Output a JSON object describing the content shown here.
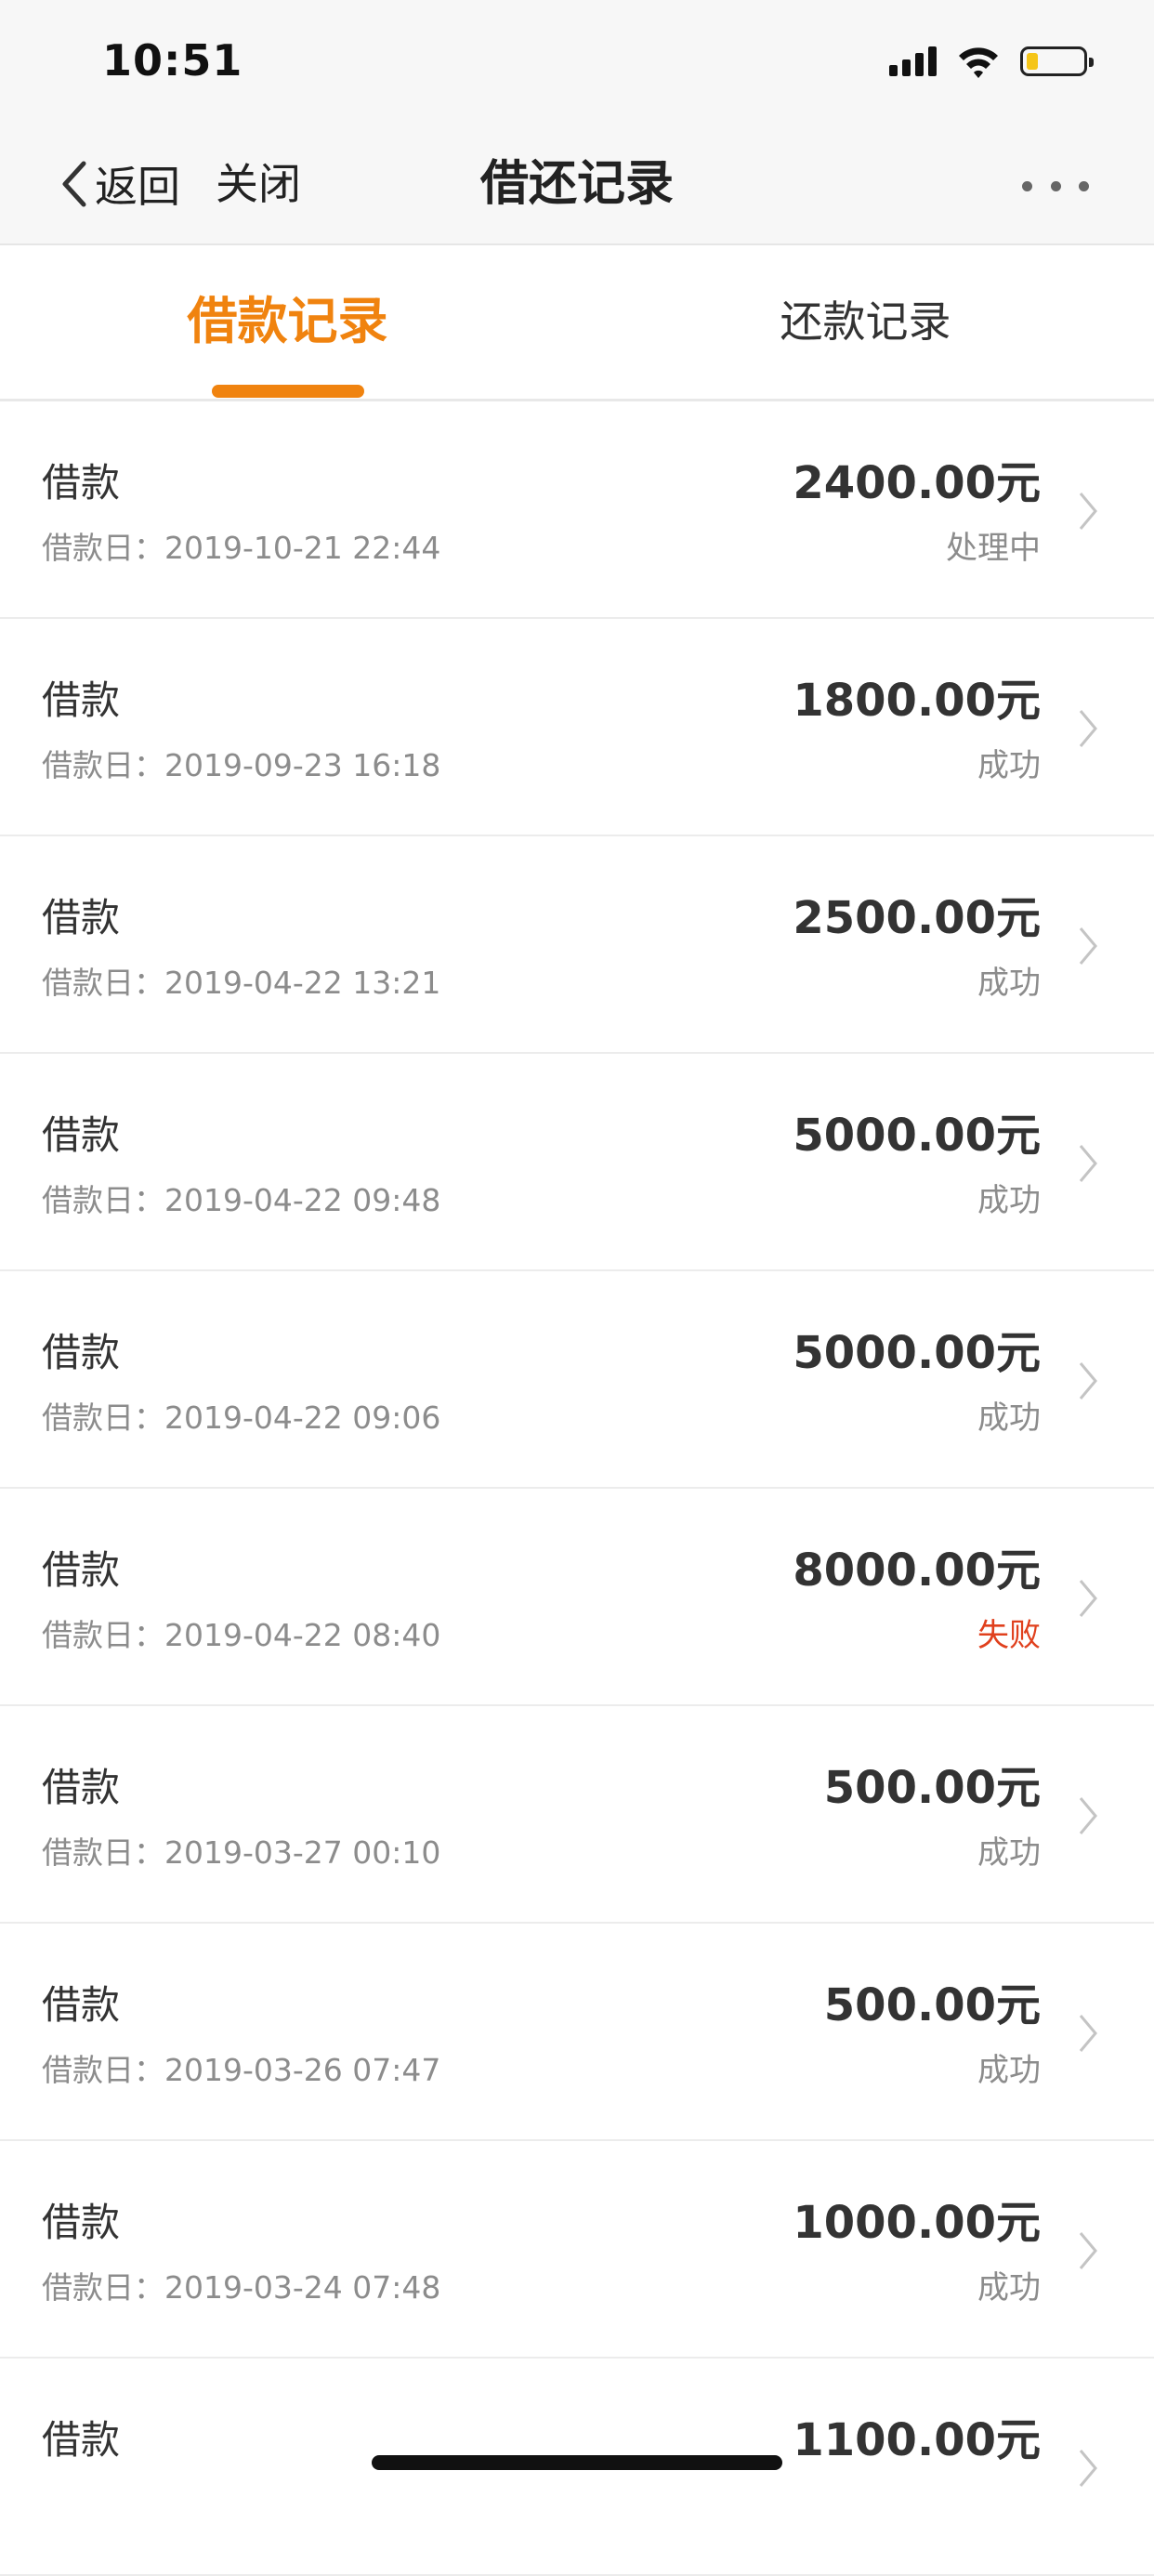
{
  "status_bar": {
    "time": "10:51"
  },
  "nav": {
    "back_label": "返回",
    "close_label": "关闭",
    "title": "借还记录"
  },
  "tabs": [
    {
      "label": "借款记录",
      "active": true
    },
    {
      "label": "还款记录",
      "active": false
    }
  ],
  "colors": {
    "accent": "#f0830f",
    "fail": "#e0401d",
    "muted": "#8c8c8c"
  },
  "records": [
    {
      "title": "借款",
      "date": "借款日：2019-10-21 22:44",
      "amount": "2400.00元",
      "status": "处理中"
    },
    {
      "title": "借款",
      "date": "借款日：2019-09-23 16:18",
      "amount": "1800.00元",
      "status": "成功"
    },
    {
      "title": "借款",
      "date": "借款日：2019-04-22 13:21",
      "amount": "2500.00元",
      "status": "成功"
    },
    {
      "title": "借款",
      "date": "借款日：2019-04-22 09:48",
      "amount": "5000.00元",
      "status": "成功"
    },
    {
      "title": "借款",
      "date": "借款日：2019-04-22 09:06",
      "amount": "5000.00元",
      "status": "成功"
    },
    {
      "title": "借款",
      "date": "借款日：2019-04-22 08:40",
      "amount": "8000.00元",
      "status": "失败"
    },
    {
      "title": "借款",
      "date": "借款日：2019-03-27 00:10",
      "amount": "500.00元",
      "status": "成功"
    },
    {
      "title": "借款",
      "date": "借款日：2019-03-26 07:47",
      "amount": "500.00元",
      "status": "成功"
    },
    {
      "title": "借款",
      "date": "借款日：2019-03-24 07:48",
      "amount": "1000.00元",
      "status": "成功"
    },
    {
      "title": "借款",
      "date": "",
      "amount": "1100.00元",
      "status": ""
    }
  ]
}
